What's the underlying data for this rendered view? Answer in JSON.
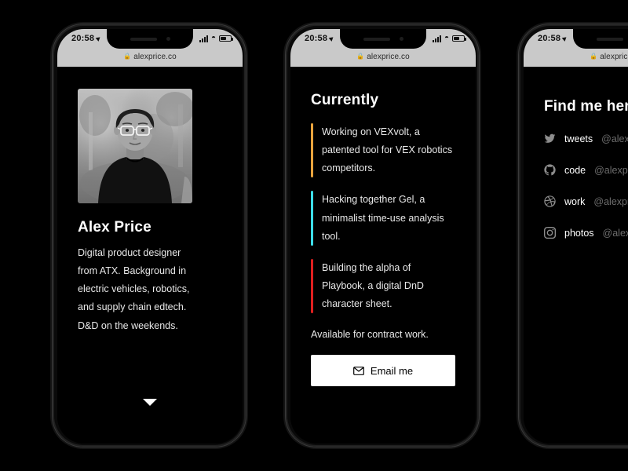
{
  "background_color": "#000000",
  "device": {
    "status_bar": {
      "time": "20:58",
      "location_icon": "location-arrow-icon",
      "signal_icon": "cellular-signal-icon",
      "wifi_icon": "wifi-icon",
      "battery_icon": "battery-icon"
    },
    "browser": {
      "lock_icon": "lock-icon",
      "url": "alexprice.co"
    },
    "home_indicator": "home-indicator"
  },
  "screens": [
    {
      "id": "profile",
      "avatar_alt": "portrait-photo-black-and-white",
      "name": "Alex Price",
      "bio": "Digital product designer from ATX. Background in electric vehicles, robotics, and supply chain edtech. D&D on the weekends.",
      "scroll_hint_icon": "chevron-down-icon"
    },
    {
      "id": "currently",
      "title": "Currently",
      "items": [
        {
          "color": "#e8a33d",
          "text": "Working on VEXvolt, a patented tool for VEX robotics competitors."
        },
        {
          "color": "#3ddde8",
          "text": "Hacking together Gel, a minimalist time-use analysis tool."
        },
        {
          "color": "#e02020",
          "text": "Building the alpha of Playbook, a digital DnD character sheet."
        }
      ],
      "availability": "Available for contract work.",
      "cta": {
        "icon": "envelope-icon",
        "label": "Email me"
      }
    },
    {
      "id": "find-me",
      "title": "Find me here",
      "links": [
        {
          "icon": "twitter-icon",
          "label": "tweets",
          "handle": "@alexpricedesign"
        },
        {
          "icon": "github-icon",
          "label": "code",
          "handle": "@alexprice"
        },
        {
          "icon": "dribbble-icon",
          "label": "work",
          "handle": "@alexprice"
        },
        {
          "icon": "instagram-icon",
          "label": "photos",
          "handle": "@alexprice"
        }
      ]
    }
  ]
}
